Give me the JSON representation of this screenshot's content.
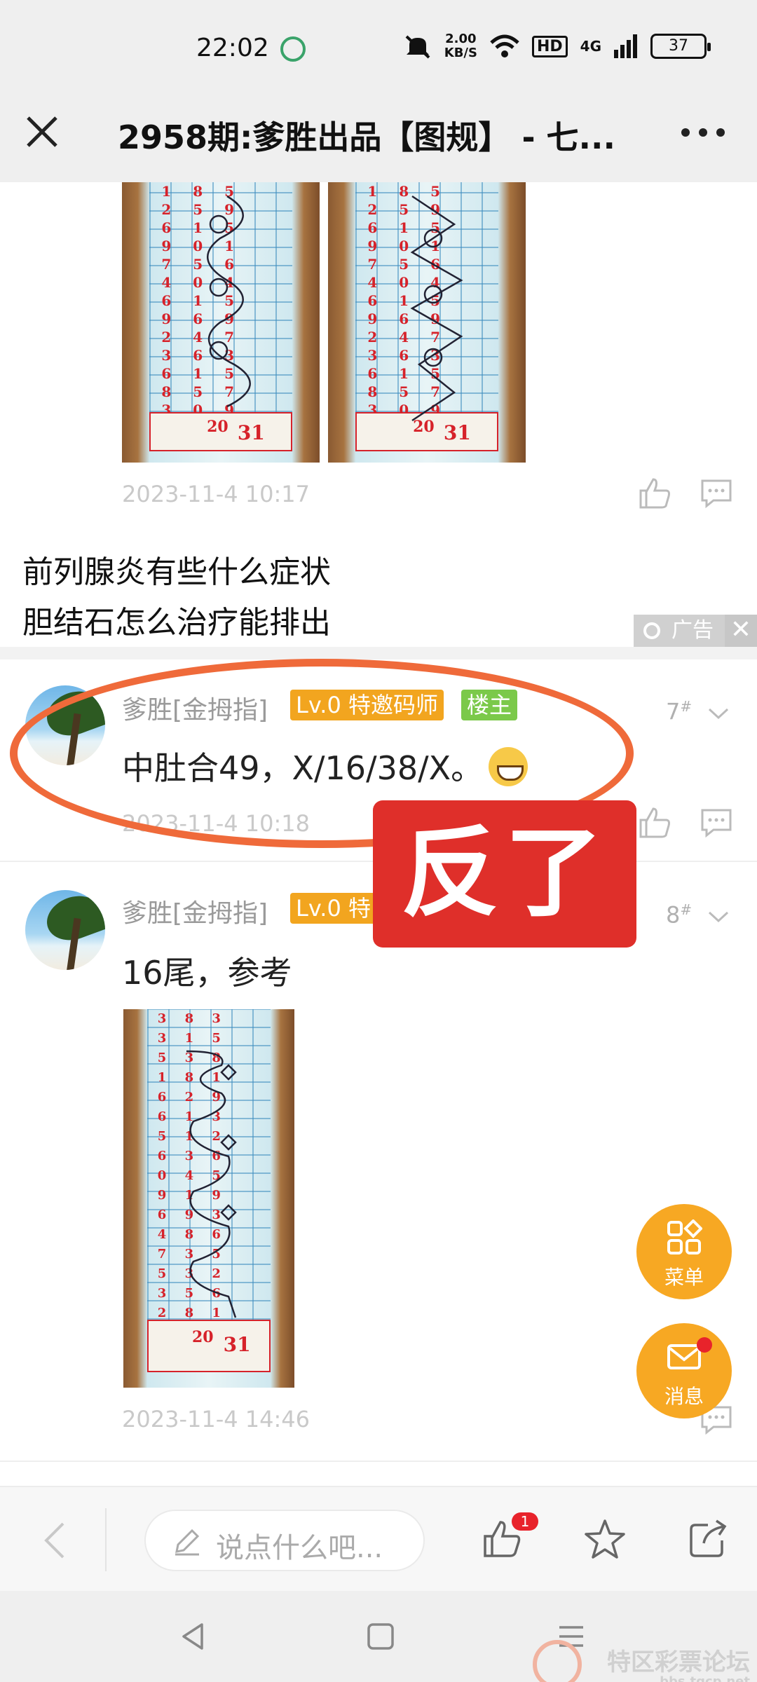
{
  "status_bar": {
    "time": "22:02",
    "net_speed_value": "2.00",
    "net_speed_unit": "KB/S",
    "hd": "HD",
    "network": "4G",
    "battery": "37"
  },
  "header": {
    "title": "2958期:爹胜出品【图规】 - 七...",
    "icons": [
      "close-icon",
      "more-icon"
    ]
  },
  "top_post": {
    "timestamp": "2023-11-4 10:17"
  },
  "ad": {
    "line1": "前列腺炎有些什么症状",
    "line2": "胆结石怎么治疗能排出",
    "badge": "广告",
    "close": "✕"
  },
  "posts": [
    {
      "username": "爹胜[金拇指]",
      "level_tag": "Lv.0 特邀码师",
      "owner_tag": "楼主",
      "floor": "7",
      "floor_mark": "#",
      "text": "中肚合49，X/16/38/X。",
      "timestamp": "2023-11-4 10:18"
    },
    {
      "username": "爹胜[金拇指]",
      "level_tag": "Lv.0 特",
      "floor": "8",
      "floor_mark": "#",
      "text": "16尾，参考",
      "timestamp": "2023-11-4 14:46"
    }
  ],
  "annotation": {
    "label": "反了",
    "color": "#df2f2a",
    "ellipse_color": "#ef6a3a"
  },
  "fabs": {
    "menu_label": "菜单",
    "message_label": "消息"
  },
  "bottom_bar": {
    "comment_placeholder": "说点什么吧...",
    "like_count": "1"
  },
  "watermark": {
    "name": "特区彩票论坛",
    "domain": "bbs.tqcp.net"
  },
  "colors": {
    "accent": "#f7a823",
    "level_tag": "#f2a51f",
    "owner_tag": "#7bc94a",
    "badge_red": "#e8232b"
  }
}
